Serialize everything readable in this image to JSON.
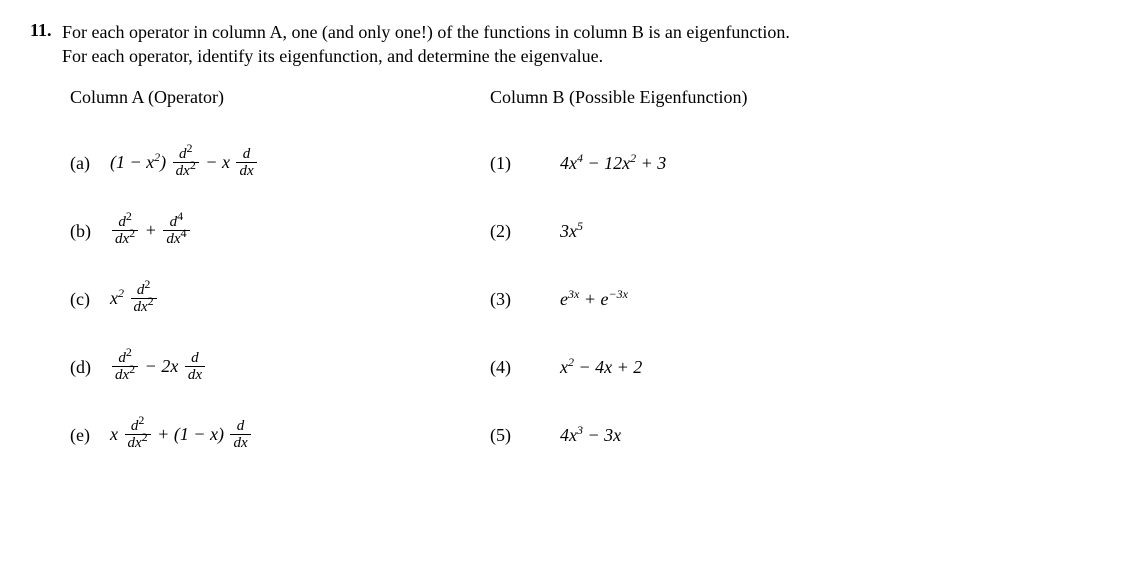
{
  "problem": {
    "number": "11.",
    "text_line1": "For each operator in column A, one (and only one!) of the functions in column B is an eigenfunction.",
    "text_line2": "For each operator, identify its eigenfunction, and determine the eigenvalue."
  },
  "columnA": {
    "header": "Column A (Operator)",
    "items": [
      {
        "label": "(a)",
        "expr_html": "(1 − <span class='it'>x</span><sup>2</sup>)&nbsp;<span class='frac'><span class='num'><span class='it'>d</span><sup>2</sup></span><span class='den'><span class='it'>dx</span><sup>2</sup></span></span> − <span class='it'>x</span>&nbsp;<span class='frac'><span class='num'><span class='it'>d</span></span><span class='den'><span class='it'>dx</span></span></span>"
      },
      {
        "label": "(b)",
        "expr_html": "<span class='frac'><span class='num'><span class='it'>d</span><sup>2</sup></span><span class='den'><span class='it'>dx</span><sup>2</sup></span></span> + <span class='frac'><span class='num'><span class='it'>d</span><sup>4</sup></span><span class='den'><span class='it'>dx</span><sup>4</sup></span></span>"
      },
      {
        "label": "(c)",
        "expr_html": "<span class='it'>x</span><sup>2</sup>&nbsp;<span class='frac'><span class='num'><span class='it'>d</span><sup>2</sup></span><span class='den'><span class='it'>dx</span><sup>2</sup></span></span>"
      },
      {
        "label": "(d)",
        "expr_html": "<span class='frac'><span class='num'><span class='it'>d</span><sup>2</sup></span><span class='den'><span class='it'>dx</span><sup>2</sup></span></span> − 2<span class='it'>x</span>&nbsp;<span class='frac'><span class='num'><span class='it'>d</span></span><span class='den'><span class='it'>dx</span></span></span>"
      },
      {
        "label": "(e)",
        "expr_html": "<span class='it'>x</span>&nbsp;<span class='frac'><span class='num'><span class='it'>d</span><sup>2</sup></span><span class='den'><span class='it'>dx</span><sup>2</sup></span></span> + (1 − <span class='it'>x</span>)&nbsp;<span class='frac'><span class='num'><span class='it'>d</span></span><span class='den'><span class='it'>dx</span></span></span>"
      }
    ]
  },
  "columnB": {
    "header": "Column B (Possible Eigenfunction)",
    "items": [
      {
        "label": "(1)",
        "expr_html": "4<span class='it'>x</span><sup>4</sup> − 12<span class='it'>x</span><sup>2</sup> + 3"
      },
      {
        "label": "(2)",
        "expr_html": "3<span class='it'>x</span><sup>5</sup>"
      },
      {
        "label": "(3)",
        "expr_html": "<span class='it'>e</span><sup>3<span class='it'>x</span></sup> + <span class='it'>e</span><sup>−3<span class='it'>x</span></sup>"
      },
      {
        "label": "(4)",
        "expr_html": "<span class='it'>x</span><sup>2</sup> − 4<span class='it'>x</span> + 2"
      },
      {
        "label": "(5)",
        "expr_html": "4<span class='it'>x</span><sup>3</sup> − 3<span class='it'>x</span>"
      }
    ]
  }
}
